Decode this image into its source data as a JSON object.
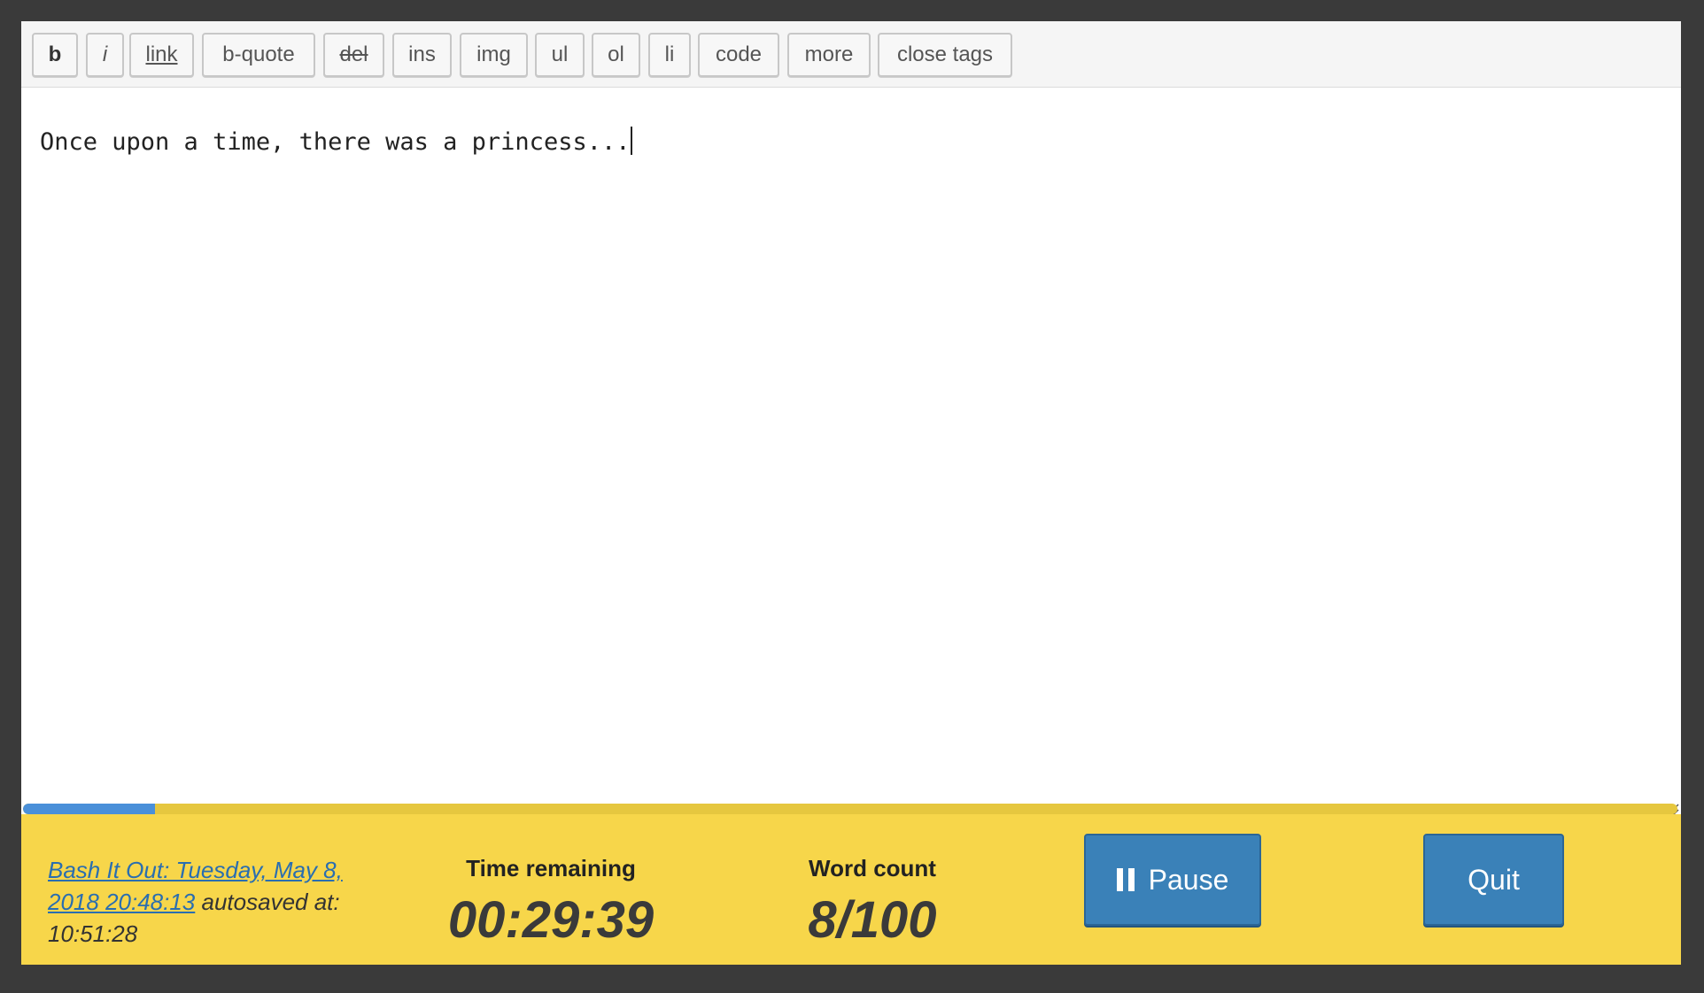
{
  "toolbar": {
    "buttons": [
      {
        "label": "b"
      },
      {
        "label": "i"
      },
      {
        "label": "link"
      },
      {
        "label": "b-quote"
      },
      {
        "label": "del"
      },
      {
        "label": "ins"
      },
      {
        "label": "img"
      },
      {
        "label": "ul"
      },
      {
        "label": "ol"
      },
      {
        "label": "li"
      },
      {
        "label": "code"
      },
      {
        "label": "more"
      },
      {
        "label": "close tags"
      }
    ]
  },
  "editor": {
    "content": "Once upon a time, there was a princess..."
  },
  "progress": {
    "fraction": 0.08
  },
  "status": {
    "link_text": "Bash It Out: Tuesday, May 8, 2018 20:48:13",
    "autosaved_label": " autosaved at: ",
    "autosaved_time": "10:51:28"
  },
  "timer": {
    "label": "Time remaining",
    "value": "00:29:39"
  },
  "words": {
    "label": "Word count",
    "value": "8/100"
  },
  "actions": {
    "pause_label": "Pause",
    "quit_label": "Quit"
  },
  "colors": {
    "bar_bg": "#f7d64a",
    "progress_fill": "#4a90d9",
    "button_blue": "#3a81b8"
  },
  "icons": {
    "pause": "pause-icon",
    "resize": "resize-grip-icon"
  }
}
